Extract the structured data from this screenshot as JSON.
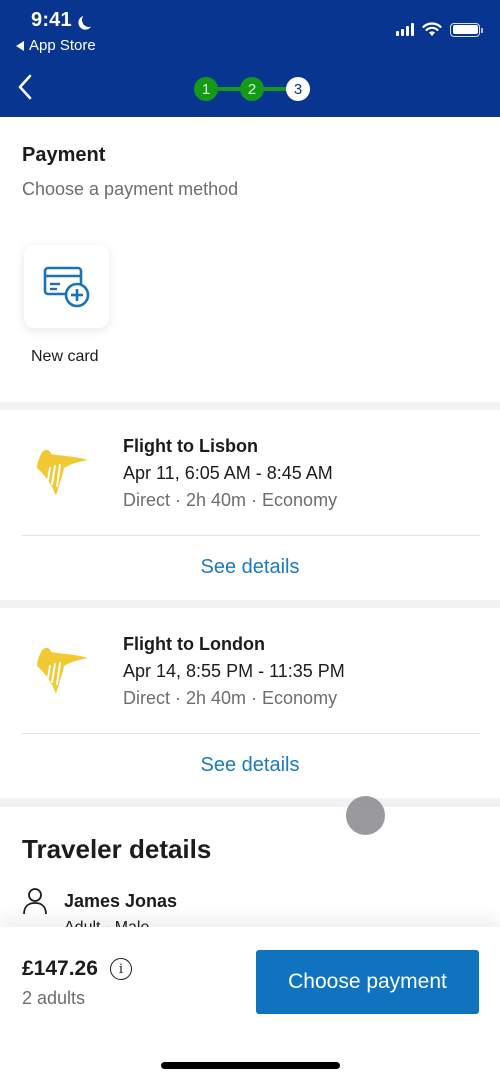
{
  "status_bar": {
    "time": "9:41",
    "back_app": "App Store"
  },
  "header": {
    "steps": [
      {
        "label": "1",
        "state": "done"
      },
      {
        "label": "2",
        "state": "done"
      },
      {
        "label": "3",
        "state": "current"
      }
    ]
  },
  "payment": {
    "title": "Payment",
    "subtitle": "Choose a payment method",
    "new_card_label": "New card"
  },
  "flights": [
    {
      "title": "Flight to Lisbon",
      "time": "Apr 11, 6:05 AM - 8:45 AM",
      "meta": "Direct · 2h 40m · Economy",
      "details_label": "See details"
    },
    {
      "title": "Flight to London",
      "time": "Apr 14, 8:55 PM - 11:35 PM",
      "meta": "Direct · 2h 40m · Economy",
      "details_label": "See details"
    }
  ],
  "traveler": {
    "title": "Traveler details",
    "name": "James Jonas",
    "meta": "Adult · Male"
  },
  "footer": {
    "price": "£147.26",
    "travelers": "2 adults",
    "button_label": "Choose payment"
  },
  "colors": {
    "header_bg": "#073590",
    "step_done": "#149a17",
    "primary_button": "#0f73bf",
    "link": "#1a7bbf",
    "airline_logo": "#f1c933"
  }
}
